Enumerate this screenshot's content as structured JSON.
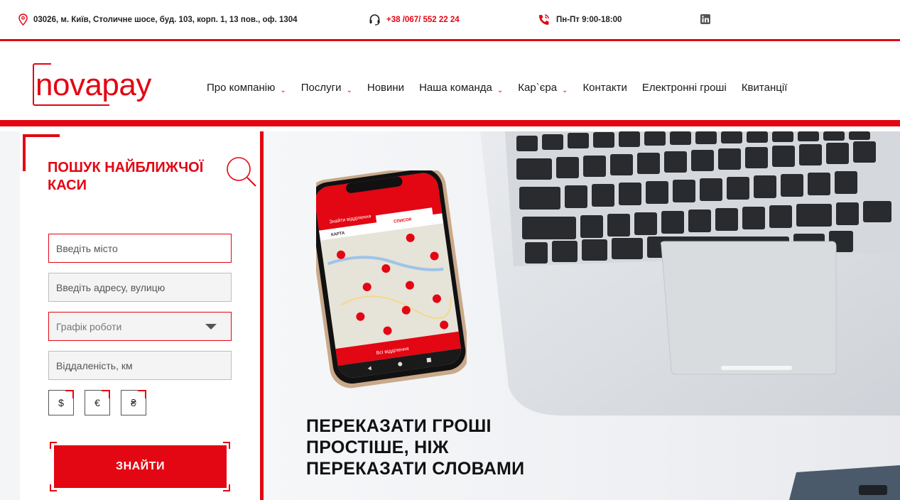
{
  "topbar": {
    "address": "03026, м. Київ, Столичне шосе, буд. 103, корп. 1, 13 пов., оф. 1304",
    "phone": "+38 /067/ 552 22 24",
    "hours": "Пн-Пт 9:00-18:00",
    "social_icon": "linkedin-icon"
  },
  "brand": {
    "logo_text": "novapay",
    "color": "#e30613"
  },
  "nav": {
    "items": [
      {
        "label": "Про компанію",
        "has_dropdown": true
      },
      {
        "label": "Послуги",
        "has_dropdown": true
      },
      {
        "label": "Новини",
        "has_dropdown": false
      },
      {
        "label": "Наша команда",
        "has_dropdown": true
      },
      {
        "label": "Кар`єра",
        "has_dropdown": true
      },
      {
        "label": "Контакти",
        "has_dropdown": false
      },
      {
        "label": "Електронні гроші",
        "has_dropdown": false
      },
      {
        "label": "Квитанції",
        "has_dropdown": false
      }
    ]
  },
  "search_panel": {
    "title": "Пошук найближчої каси",
    "city_placeholder": "Введіть місто",
    "address_placeholder": "Введіть адресу, вулицю",
    "schedule_label": "Графік роботи",
    "distance_placeholder": "Віддаленість, км",
    "currencies": [
      "$",
      "€",
      "₴"
    ],
    "find_label": "Знайти"
  },
  "hero": {
    "headline_lines": [
      "Переказати гроші",
      "простіше, ніж",
      "переказати словами"
    ],
    "phone_screen": {
      "header": "Знайти відділення",
      "tab_map": "КАРТА",
      "tab_list": "СПИСОК",
      "footer": "Всі відділення"
    }
  }
}
